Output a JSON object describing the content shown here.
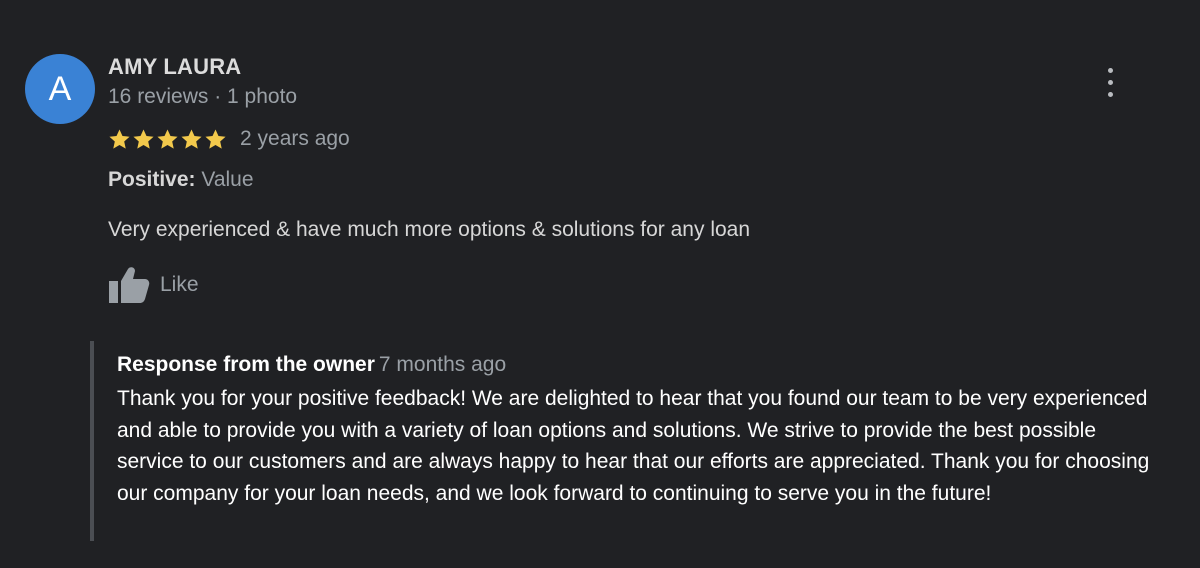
{
  "reviewer": {
    "avatar_letter": "A",
    "avatar_color": "#3a82d5",
    "name": "AMY LAURA",
    "meta": "16 reviews · 1 photo"
  },
  "review": {
    "rating": 5,
    "rating_max": 5,
    "star_color": "#f2c94c",
    "time": "2 years ago",
    "positive_label": "Positive:",
    "positive_value": " Value",
    "text": "Very experienced & have much more options & solutions for any loan",
    "like_label": "Like",
    "like_icon": "thumbs-up-icon",
    "more_icon": "more-vert-icon"
  },
  "response": {
    "title": "Response from the owner",
    "time": "7 months ago",
    "text": "Thank you for your positive feedback! We are delighted to hear that you found our team to be very experienced and able to provide you with a variety of loan options and solutions. We strive to provide the best possible service to our customers and are always happy to hear that our efforts are appreciated. Thank you for choosing our company for your loan needs, and we look forward to continuing to serve you in the future!"
  }
}
